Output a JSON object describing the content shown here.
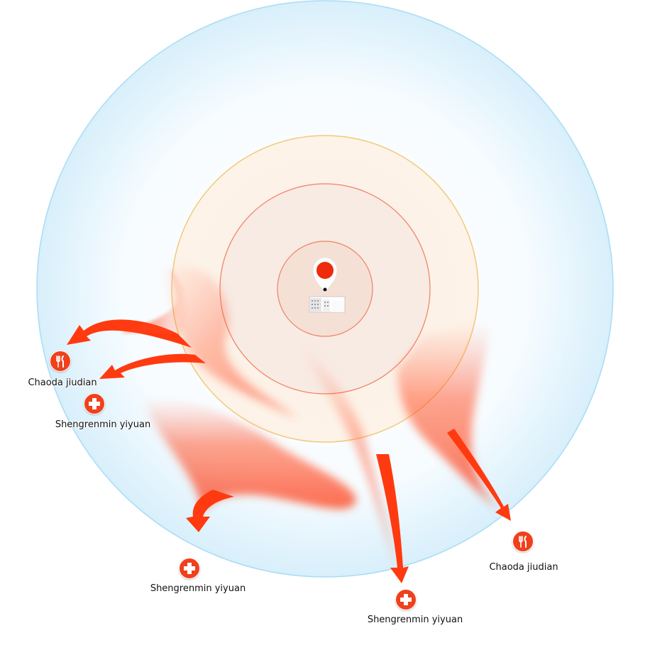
{
  "colors": {
    "outer_ring": "#a9dcf5",
    "middle_ring": "#f3c97a",
    "inner_ring": "#f08060",
    "flow": "#ff3a10",
    "icon_bg": "#f0401c"
  },
  "center": {
    "icon": "location-pin-icon",
    "building_icon": "building-icon"
  },
  "pois": [
    {
      "id": "poi-1",
      "type": "restaurant",
      "icon": "fork-knife-icon",
      "label": "Chaoda jiudian"
    },
    {
      "id": "poi-2",
      "type": "hospital",
      "icon": "cross-icon",
      "label": "Shengrenmin  yiyuan"
    },
    {
      "id": "poi-3",
      "type": "hospital",
      "icon": "cross-icon",
      "label": "Shengrenmin  yiyuan"
    },
    {
      "id": "poi-4",
      "type": "hospital",
      "icon": "cross-icon",
      "label": "Shengrenmin  yiyuan"
    },
    {
      "id": "poi-5",
      "type": "restaurant",
      "icon": "fork-knife-icon",
      "label": "Chaoda jiudian"
    }
  ]
}
